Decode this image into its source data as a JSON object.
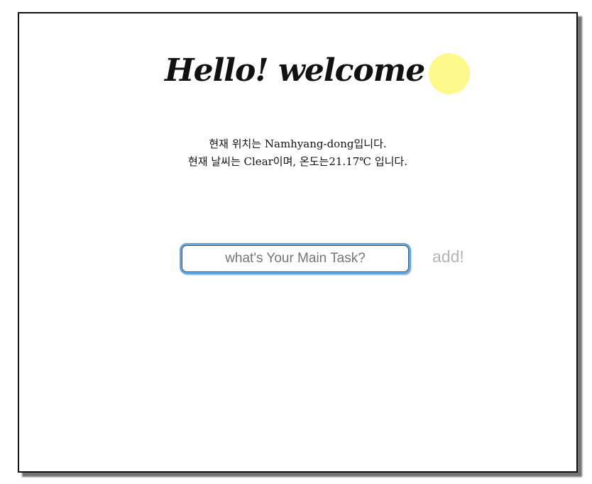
{
  "header": {
    "title": "Hello! welcome"
  },
  "weather": {
    "location_line": "현재 위치는 Namhyang-dong입니다.",
    "weather_line": "현재 날씨는 Clear이며, 온도는21.17℃ 입니다.",
    "sun_color": "#fdf98a"
  },
  "task_form": {
    "placeholder": "what's Your Main Task?",
    "value": "",
    "add_label": "add!"
  }
}
